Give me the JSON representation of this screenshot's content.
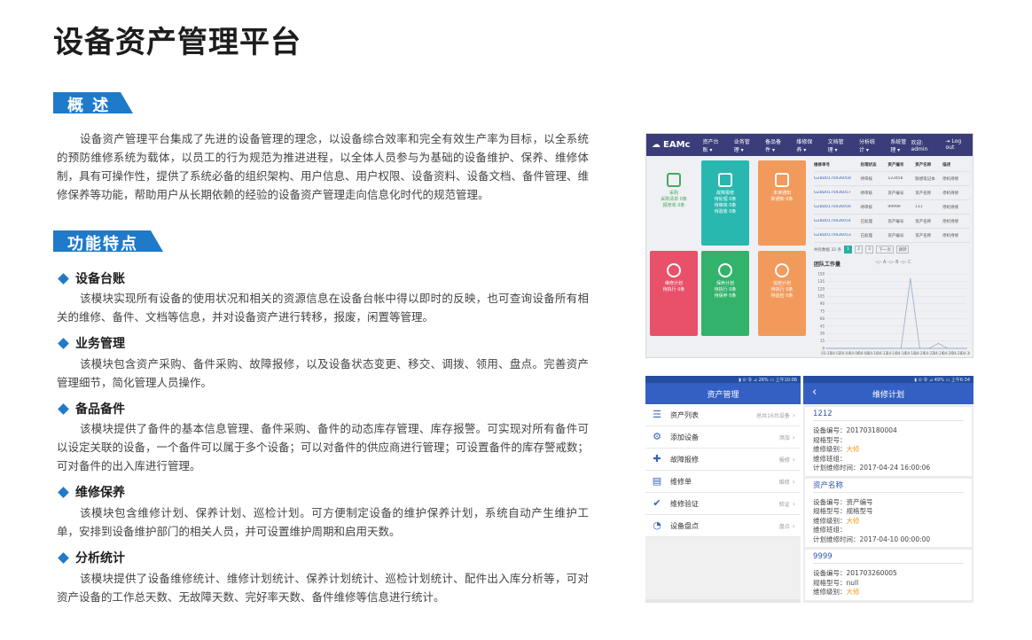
{
  "title": "设备资产管理平台",
  "overview": {
    "heading": "概 述",
    "text": "设备资产管理平台集成了先进的设备管理的理念，以设备综合效率和完全有效生产率为目标，以全系统的预防维修系统为载体，以员工的行为规范为推进进程，以全体人员参与为基础的设备维护、保养、维修体制，具有可操作性，提供了系统必备的组织架构、用户信息、用户权限、设备资料、设备文档、备件管理、维修保养等功能，帮助用户从长期依赖的经验的设备资产管理走向信息化时代的规范管理。"
  },
  "features": {
    "heading": "功能特点",
    "items": [
      {
        "title": "设备台账",
        "text": "该模块实现所有设备的使用状况和相关的资源信息在设备台帐中得以即时的反映，也可查询设备所有相关的维修、备件、文档等信息，并对设备资产进行转移，报废，闲置等管理。"
      },
      {
        "title": "业务管理",
        "text": "该模块包含资产采购、备件采购、故障报修，以及设备状态变更、移交、调拨、领用、盘点。完善资产管理细节，简化管理人员操作。"
      },
      {
        "title": "备品备件",
        "text": "该模块提供了备件的基本信息管理、备件采购、备件的动态库存管理、库存报警。可实现对所有备件可以设定关联的设备，一个备件可以属于多个设备；可以对备件的供应商进行管理；可设置备件的库存警戒数；可对备件的出入库进行管理。"
      },
      {
        "title": "维修保养",
        "text": "该模块包含维修计划、保养计划、巡检计划。可方便制定设备的维护保养计划，系统自动产生维护工单，安排到设备维护部门的相关人员，并可设置维护周期和启用天数。"
      },
      {
        "title": "分析统计",
        "text": "该模块提供了设备维修统计、维修计划统计、保养计划统计、巡检计划统计、配件出入库分析等，可对资产设备的工作总天数、无故障天数、完好率天数、备件维修等信息进行统计。"
      }
    ]
  },
  "desktop": {
    "logo": "EAMc",
    "menu": [
      "资产台账 ▾",
      "业务管理 ▾",
      "备品备件 ▾",
      "维修保养 ▾",
      "文档管理 ▾",
      "分析统计 ▾",
      "系统管理 ▾"
    ],
    "user": "欢迎: admin",
    "logout": "⇥ Log out",
    "tiles": [
      {
        "label": "采购",
        "sub": "采购清单 0条\n报修单 0条",
        "color": "#eef0f3",
        "text_color": "#4aa85e"
      },
      {
        "label": "故障报修",
        "sub": "待处理 0条\n待审核 0条\n待验收 0条",
        "color": "#28b8b0"
      },
      {
        "label": "未读通知",
        "sub": "新通知 0条",
        "color": "#f29a5c"
      },
      {
        "label": "维修计划",
        "sub": "待执行 0条",
        "color": "#e9506a"
      },
      {
        "label": "保养计划",
        "sub": "待执行 0条\n待保养 0条",
        "color": "#33b26c"
      },
      {
        "label": "巡检计划",
        "sub": "待执行 0条\n待巡检 0条",
        "color": "#f29a5c"
      }
    ],
    "table_headers": [
      "维修单号",
      "处理状态",
      "资产编号",
      "资产名称",
      "描述"
    ],
    "table_rows": [
      [
        "GZBD0170436058",
        "待审核",
        "123456",
        "联想笔记本",
        "停机待修"
      ],
      [
        "GZBD0170436057",
        "待审核",
        "资产编号",
        "资产名称",
        "停机待修"
      ],
      [
        "GZBD0170436056",
        "待审核",
        "99999",
        "111",
        "停机待修"
      ],
      [
        "GZBD0170436054",
        "已处理",
        "资产编号",
        "资产名称",
        "停机待修"
      ],
      [
        "GZBD0170436053",
        "已处理",
        "资产编号",
        "资产名称",
        "停机待修"
      ]
    ],
    "pager": {
      "info": "共有数据 32 条",
      "pages": [
        "1",
        "2",
        "3"
      ],
      "next": "下一页",
      "go": "跳转"
    },
    "team_title": "团队工作量",
    "team_legend": "-◇- A  -◇- B  -◇- C"
  },
  "chart_data": {
    "type": "line",
    "title": "团队工作量",
    "categories": [
      "03-31",
      "04-02",
      "04-04",
      "04-06",
      "04-08",
      "04-10",
      "04-12",
      "04-14",
      "04-16",
      "04-18",
      "04-20",
      "04-22",
      "04-24",
      "04-26",
      "04-28",
      "04-30"
    ],
    "series": [
      {
        "values": [
          0,
          0,
          0,
          0,
          0,
          0,
          0,
          0,
          0,
          140,
          0,
          0,
          0,
          0,
          0,
          0
        ]
      },
      {
        "values": [
          0,
          0,
          0,
          0,
          0,
          0,
          0,
          0,
          0,
          0,
          0,
          0,
          10,
          0,
          0,
          0
        ]
      }
    ],
    "ylim": [
      0,
      150
    ],
    "yticks": [
      0,
      15,
      30,
      45,
      60,
      75,
      90,
      105,
      120,
      135,
      150
    ],
    "colors": [
      "#9aa9c8",
      "#9aa9c8"
    ]
  },
  "phone_asset": {
    "status": "▮ ⊙ 令 ⊿ 26% ▭ 上午10:06",
    "header": "资产管理",
    "rows": [
      {
        "icon": "list-icon",
        "glyph": "☰",
        "label": "资产列表",
        "sub": "总共16台设备"
      },
      {
        "icon": "gear-icon",
        "glyph": "⚙",
        "label": "添加设备",
        "sub": "添加"
      },
      {
        "icon": "wrench-icon",
        "glyph": "✚",
        "label": "故障报修",
        "sub": "报修"
      },
      {
        "icon": "clipboard-icon",
        "glyph": "▤",
        "label": "维修单",
        "sub": "维修"
      },
      {
        "icon": "check-icon",
        "glyph": "✔",
        "label": "维修验证",
        "sub": "验证"
      },
      {
        "icon": "clock-icon",
        "glyph": "◔",
        "label": "设备盘点",
        "sub": "盘点"
      }
    ]
  },
  "phone_plan": {
    "status": "▮ ⊙ 令 ⊿ 49% ▭ 上午6:34",
    "header": "维修计划",
    "back": "‹",
    "cards": [
      {
        "title": "1212",
        "lines": [
          [
            "设备编号：",
            "201703180004"
          ],
          [
            "规格型号：",
            ""
          ],
          [
            "维修级别：",
            "大修"
          ],
          [
            "维修班组：",
            ""
          ],
          [
            "计划维修时间：",
            "2017-04-24 16:00:06"
          ]
        ]
      },
      {
        "title": "资产名称",
        "lines": [
          [
            "设备编号：",
            "资产编号"
          ],
          [
            "规格型号：",
            "规格型号"
          ],
          [
            "维修级别：",
            "大修"
          ],
          [
            "维修班组：",
            ""
          ],
          [
            "计划维修时间：",
            "2017-04-10 00:00:00"
          ]
        ]
      },
      {
        "title": "9999",
        "lines": [
          [
            "设备编号：",
            "201703260005"
          ],
          [
            "规格型号：",
            "null"
          ],
          [
            "维修级别：",
            "大修"
          ]
        ]
      }
    ]
  }
}
